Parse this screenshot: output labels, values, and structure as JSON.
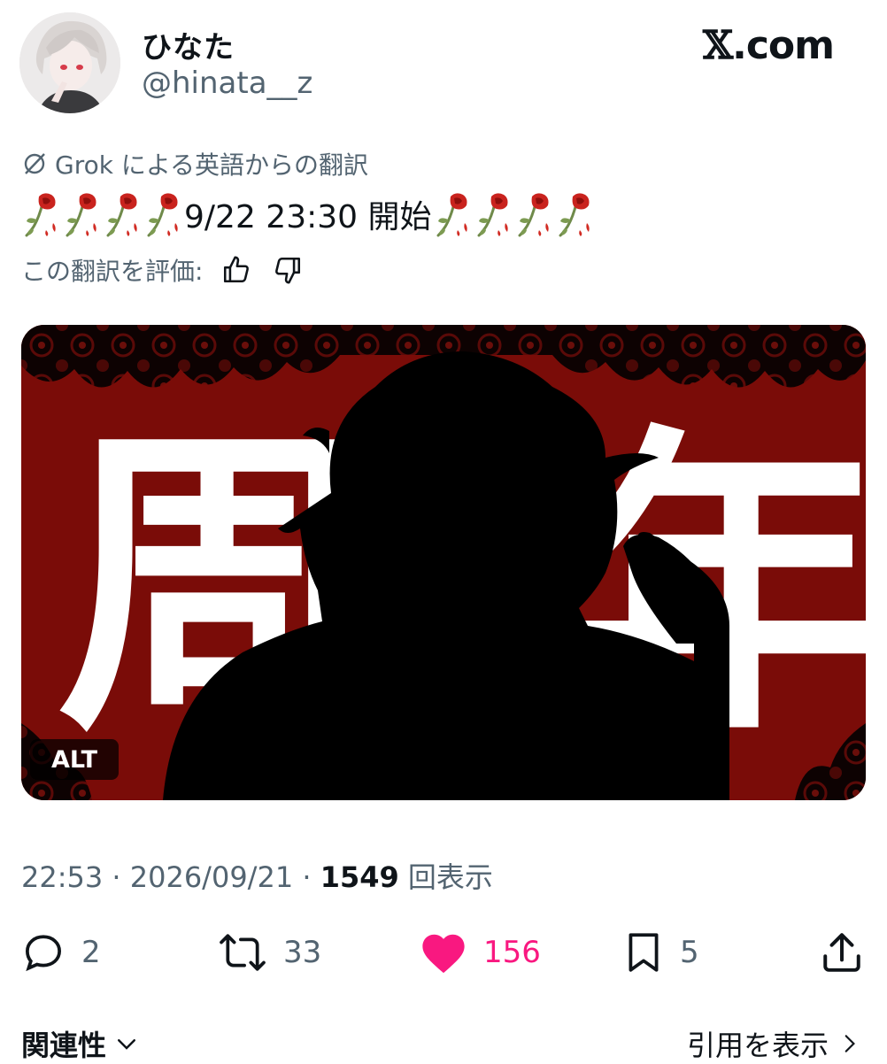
{
  "brand": {
    "label": "𝕏.com",
    "x_glyph": "𝕏",
    "suffix": ".com"
  },
  "author": {
    "display_name": "ひなた",
    "handle": "@hinata__z"
  },
  "translation": {
    "label": "Grok による英語からの翻訳",
    "text": "9/22 23:30 開始",
    "rate_label": "この翻訳を評価:"
  },
  "media": {
    "alt_label": "ALT",
    "image_text_left": "周",
    "image_text_right": "年",
    "bg_color": "#7a0c08"
  },
  "meta": {
    "time": "22:53",
    "separator": " · ",
    "date": "2026/09/21",
    "views": "1549",
    "views_label": "回表示"
  },
  "actions": {
    "replies": "2",
    "reposts": "33",
    "likes": "156",
    "bookmarks": "5"
  },
  "footer": {
    "relevance": "関連性",
    "quotes": "引用を表示"
  },
  "colors": {
    "like": "#f91880",
    "muted": "#536471",
    "text": "#0f1419"
  },
  "icons": [
    "grok-icon",
    "thumbs-up-icon",
    "thumbs-down-icon",
    "rose-emoji",
    "reply-icon",
    "repost-icon",
    "heart-icon",
    "bookmark-icon",
    "share-icon",
    "chevron-down-icon",
    "chevron-right-icon"
  ]
}
